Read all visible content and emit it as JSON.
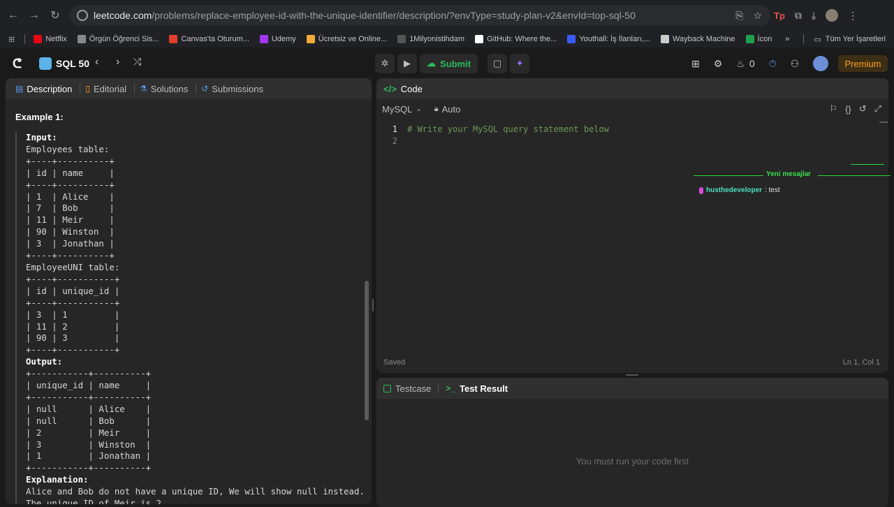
{
  "browser": {
    "url_host": "leetcode.com",
    "url_path": "/problems/replace-employee-id-with-the-unique-identifier/description/?envType=study-plan-v2&envId=top-sql-50",
    "bookmarks": [
      {
        "label": "Netflix",
        "color": "#e50914"
      },
      {
        "label": "Örgün Öğrenci Sis...",
        "color": "#888888"
      },
      {
        "label": "Canvas'ta Oturum...",
        "color": "#e13f2b"
      },
      {
        "label": "Udemy",
        "color": "#a435f0"
      },
      {
        "label": "Ücretsiz ve Online...",
        "color": "#f2a93b"
      },
      {
        "label": "1Milyonistihdam",
        "color": "#555555"
      },
      {
        "label": "GitHub: Where the...",
        "color": "#ffffff"
      },
      {
        "label": "Youthall: İş İlanları,...",
        "color": "#3b5bff"
      },
      {
        "label": "Wayback Machine",
        "color": "#cccccc"
      },
      {
        "label": "İcon",
        "color": "#1e9e4f"
      }
    ],
    "bookmarks_folder": "Tüm Yer İşaretleri"
  },
  "nav": {
    "study_plan_title": "SQL 50",
    "submit_label": "Submit",
    "streak_count": "0",
    "premium_label": "Premium"
  },
  "left_tabs": {
    "description": "Description",
    "editorial": "Editorial",
    "solutions": "Solutions",
    "submissions": "Submissions"
  },
  "problem": {
    "example_title": "Example 1:",
    "input_label": "Input:",
    "input_lines": "Employees table:\n+----+----------+\n| id | name     |\n+----+----------+\n| 1  | Alice    |\n| 7  | Bob      |\n| 11 | Meir     |\n| 90 | Winston  |\n| 3  | Jonathan |\n+----+----------+\nEmployeeUNI table:\n+----+-----------+\n| id | unique_id |\n+----+-----------+\n| 3  | 1         |\n| 11 | 2         |\n| 90 | 3         |\n+----+-----------+",
    "output_label": "Output:",
    "output_lines": "+-----------+----------+\n| unique_id | name     |\n+-----------+----------+\n| null      | Alice    |\n| null      | Bob      |\n| 2         | Meir     |\n| 3         | Winston  |\n| 1         | Jonathan |\n+-----------+----------+",
    "explanation_label": "Explanation:",
    "explanation_text": "Alice and Bob do not have a unique ID, We will show null instead.\nThe unique ID of Meir is 2."
  },
  "code": {
    "header": "Code",
    "language": "MySQL",
    "mode": "Auto",
    "lines": [
      "# Write your MySQL query statement below",
      ""
    ],
    "line_numbers": [
      "1",
      "2"
    ],
    "saved_status": "Saved",
    "cursor_position": "Ln 1, Col 1"
  },
  "chat": {
    "divider_label": "Yeni mesajlar",
    "username": "husthedeveloper",
    "message": ": test"
  },
  "test": {
    "testcase_tab": "Testcase",
    "result_tab": "Test Result",
    "empty_message": "You must run your code first"
  }
}
